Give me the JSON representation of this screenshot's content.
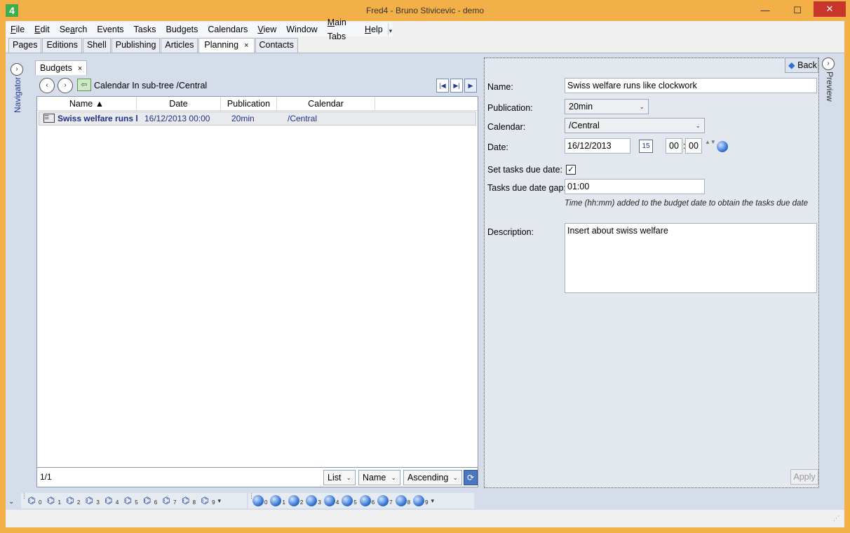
{
  "window": {
    "app_icon": "4",
    "title": "Fred4 - Bruno Stivicevic - demo",
    "minimize": "—",
    "maximize": "☐",
    "close": "✕"
  },
  "menu": {
    "items": [
      {
        "name": "file",
        "pre": "",
        "acc": "F",
        "post": "ile"
      },
      {
        "name": "edit",
        "pre": "",
        "acc": "E",
        "post": "dit"
      },
      {
        "name": "search",
        "pre": "Se",
        "acc": "a",
        "post": "rch"
      },
      {
        "name": "events",
        "pre": "Events",
        "acc": "",
        "post": ""
      },
      {
        "name": "tasks",
        "pre": "Tasks",
        "acc": "",
        "post": ""
      },
      {
        "name": "budgets",
        "pre": "Budgets",
        "acc": "",
        "post": ""
      },
      {
        "name": "calendars",
        "pre": "Calendars",
        "acc": "",
        "post": ""
      },
      {
        "name": "view",
        "pre": "",
        "acc": "V",
        "post": "iew"
      },
      {
        "name": "window",
        "pre": "Window",
        "acc": "",
        "post": ""
      },
      {
        "name": "main-tabs",
        "pre": "",
        "acc": "M",
        "post": "ain Tabs"
      },
      {
        "name": "help",
        "pre": "",
        "acc": "H",
        "post": "elp"
      }
    ],
    "overflow": "▾"
  },
  "main_tabs": [
    {
      "label": "Pages",
      "active": false
    },
    {
      "label": "Editions",
      "active": false
    },
    {
      "label": "Shell",
      "active": false
    },
    {
      "label": "Publishing",
      "active": false
    },
    {
      "label": "Articles",
      "active": false
    },
    {
      "label": "Planning",
      "active": true
    },
    {
      "label": "Contacts",
      "active": false
    }
  ],
  "tab_close": "×",
  "navigator": {
    "label": "Navigator",
    "toggle": "›"
  },
  "preview": {
    "label": "Preview",
    "toggle": "›"
  },
  "budgets": {
    "tab_label": "Budgets",
    "tab_close": "×",
    "back_nav": "‹",
    "fwd_nav": "›",
    "up_icon": "⇦",
    "breadcrumb": "Calendar In sub-tree /Central",
    "pager": {
      "first": "|◀",
      "prev": "▶|",
      "next": "▶"
    },
    "columns": [
      {
        "label": "Name ▲",
        "width": 142
      },
      {
        "label": "Date",
        "width": 120
      },
      {
        "label": "Publication",
        "width": 80
      },
      {
        "label": "Calendar",
        "width": 140
      }
    ],
    "row": {
      "icon": "☰",
      "name": "Swiss welfare runs l",
      "date": "16/12/2013 00:00",
      "publication": "20min",
      "calendar": "/Central"
    },
    "count": "1/1",
    "view_mode": "List",
    "sort_field": "Name",
    "sort_order": "Ascending",
    "combo_arrow": "⌄",
    "refresh_icon": "⟳"
  },
  "detail": {
    "back_label": "Back",
    "name_label": "Name:",
    "name_value": "Swiss welfare runs like clockwork",
    "publication_label": "Publication:",
    "publication_value": "20min",
    "calendar_label": "Calendar:",
    "calendar_value": "/Central",
    "date_label": "Date:",
    "date_value": "16/12/2013",
    "calendar_icon": "15",
    "hour": "00",
    "time_sep": ":",
    "minute": "00",
    "spinner": "▲▼",
    "set_tasks_label": "Set tasks due date:",
    "set_tasks_checked": "✓",
    "gap_label": "Tasks due date gap:",
    "gap_value": "01:00",
    "gap_hint": "Time (hh:mm) added to the budget date to obtain the tasks due date",
    "description_label": "Description:",
    "description_value": "Insert about swiss welfare",
    "apply_label": "Apply"
  },
  "bottom_toolbar": {
    "left_arrow": "⌄",
    "grip": "⋮",
    "more": "▾",
    "binoculars": [
      "0",
      "1",
      "2",
      "3",
      "4",
      "5",
      "6",
      "7",
      "8",
      "9"
    ],
    "globes": [
      "0",
      "1",
      "2",
      "3",
      "4",
      "5",
      "6",
      "7",
      "8",
      "9"
    ],
    "binoc_glyph": "⌬"
  }
}
